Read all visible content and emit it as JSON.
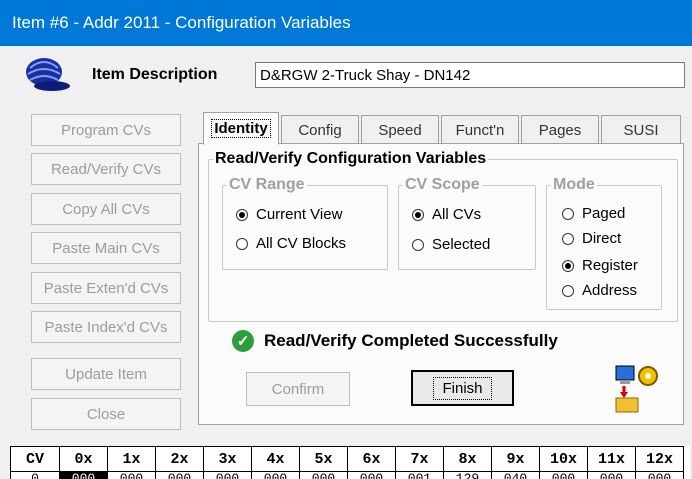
{
  "window": {
    "title": "Item #6 - Addr 2011 - Configuration Variables"
  },
  "item_description": {
    "label": "Item Description",
    "value": "D&RGW 2-Truck Shay - DN142"
  },
  "left_buttons": [
    "Program CVs",
    "Read/Verify CVs",
    "Copy All CVs",
    "Paste Main CVs",
    "Paste Exten'd CVs",
    "Paste Index'd CVs",
    "Update Item",
    "Close"
  ],
  "tabs": [
    "Identity",
    "Config",
    "Speed",
    "Funct'n",
    "Pages",
    "SUSI"
  ],
  "panel": {
    "title": "Read/Verify Configuration Variables",
    "cv_range": {
      "title": "CV Range",
      "options": [
        "Current View",
        "All CV Blocks"
      ],
      "selected": 0
    },
    "cv_scope": {
      "title": "CV Scope",
      "options": [
        "All CVs",
        "Selected"
      ],
      "selected": 0
    },
    "mode": {
      "title": "Mode",
      "options": [
        "Paged",
        "Direct",
        "Register",
        "Address"
      ],
      "selected": 2
    },
    "status": "Read/Verify Completed Successfully",
    "confirm_label": "Confirm",
    "finish_label": "Finish"
  },
  "cv_table": {
    "headers": [
      "CV",
      "0x",
      "1x",
      "2x",
      "3x",
      "4x",
      "5x",
      "6x",
      "7x",
      "8x",
      "9x",
      "10x",
      "11x",
      "12x"
    ],
    "row": [
      "0",
      "000",
      "000",
      "000",
      "000",
      "000",
      "000",
      "000",
      "001",
      "129",
      "040",
      "000",
      "000",
      "000"
    ]
  },
  "colors": {
    "titlebar": "#0078d7",
    "check": "#2e9e3a"
  }
}
